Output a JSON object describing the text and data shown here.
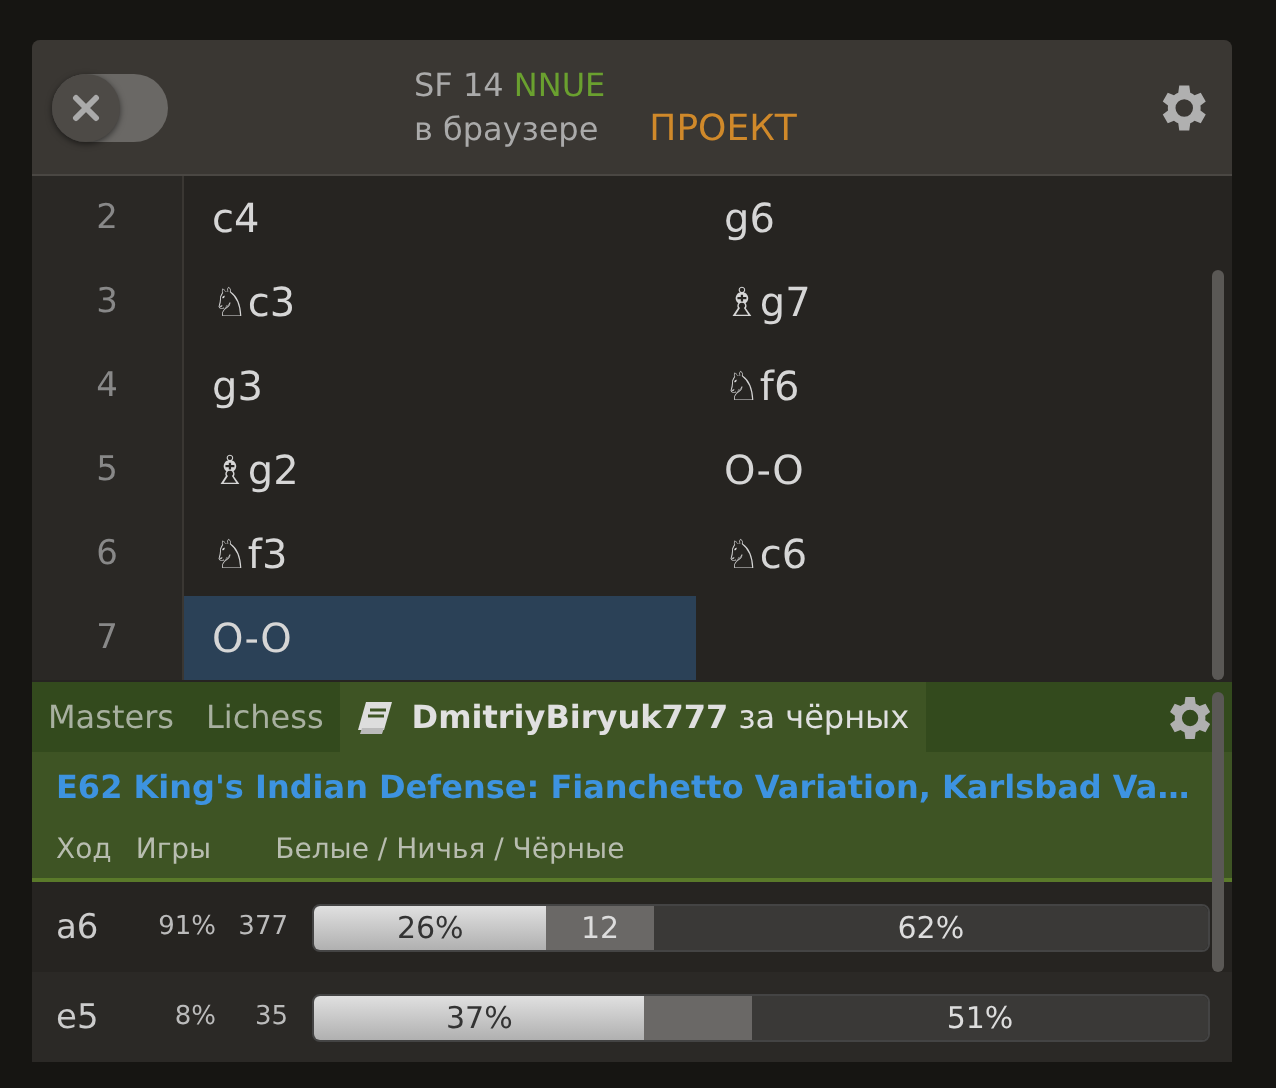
{
  "engine": {
    "on": false,
    "name": "SF 14",
    "tag": "NNUE",
    "subtitle": "в браузере",
    "status": "ПРОЕКТ"
  },
  "moves": [
    {
      "number": "2",
      "white": {
        "san": "c4",
        "selected": false
      },
      "black": {
        "san": "g6",
        "selected": false
      }
    },
    {
      "number": "3",
      "white": {
        "san": "♘c3",
        "selected": false
      },
      "black": {
        "san": "♗g7",
        "selected": false
      }
    },
    {
      "number": "4",
      "white": {
        "san": "g3",
        "selected": false
      },
      "black": {
        "san": "♘f6",
        "selected": false
      }
    },
    {
      "number": "5",
      "white": {
        "san": "♗g2",
        "selected": false
      },
      "black": {
        "san": "O-O",
        "selected": false
      }
    },
    {
      "number": "6",
      "white": {
        "san": "♘f3",
        "selected": false
      },
      "black": {
        "san": "♘c6",
        "selected": false
      }
    },
    {
      "number": "7",
      "white": {
        "san": "O-O",
        "selected": true
      }
    }
  ],
  "explorer": {
    "tabs": [
      {
        "label": "Masters",
        "selected": false
      },
      {
        "label": "Lichess",
        "selected": false
      },
      {
        "label": "**DmitriyBiryuk777** за чёрных",
        "selected": true,
        "kind": "player"
      }
    ],
    "opening": "E62 King's Indian Defense: Fianchetto Variation, Karlsbad Va…",
    "columns": [
      "Ход",
      "Игры",
      "Белые / Ничья / Чёрные"
    ],
    "rows": [
      {
        "move": "a6",
        "share": "91%",
        "games": "377",
        "white": {
          "level": 0.26,
          "label": "26%"
        },
        "draw": {
          "label": "12"
        },
        "black": {
          "level": 0.62,
          "label": "62%"
        }
      },
      {
        "move": "e5",
        "share": "8%",
        "games": "35",
        "white": {
          "level": 0.37,
          "label": "37%"
        },
        "draw": {},
        "black": {
          "level": 0.51,
          "label": "51%"
        }
      }
    ]
  }
}
